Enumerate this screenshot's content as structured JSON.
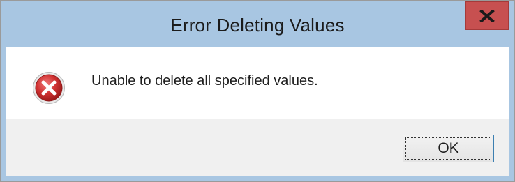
{
  "dialog": {
    "title": "Error Deleting Values",
    "message": "Unable to delete all specified values.",
    "icon": "error-icon",
    "ok_label": "OK",
    "close_icon": "close-icon"
  },
  "colors": {
    "titlebar": "#a8c6e2",
    "close_button": "#c75050",
    "footer": "#f0f0f0",
    "error_icon": "#c62a2a"
  }
}
